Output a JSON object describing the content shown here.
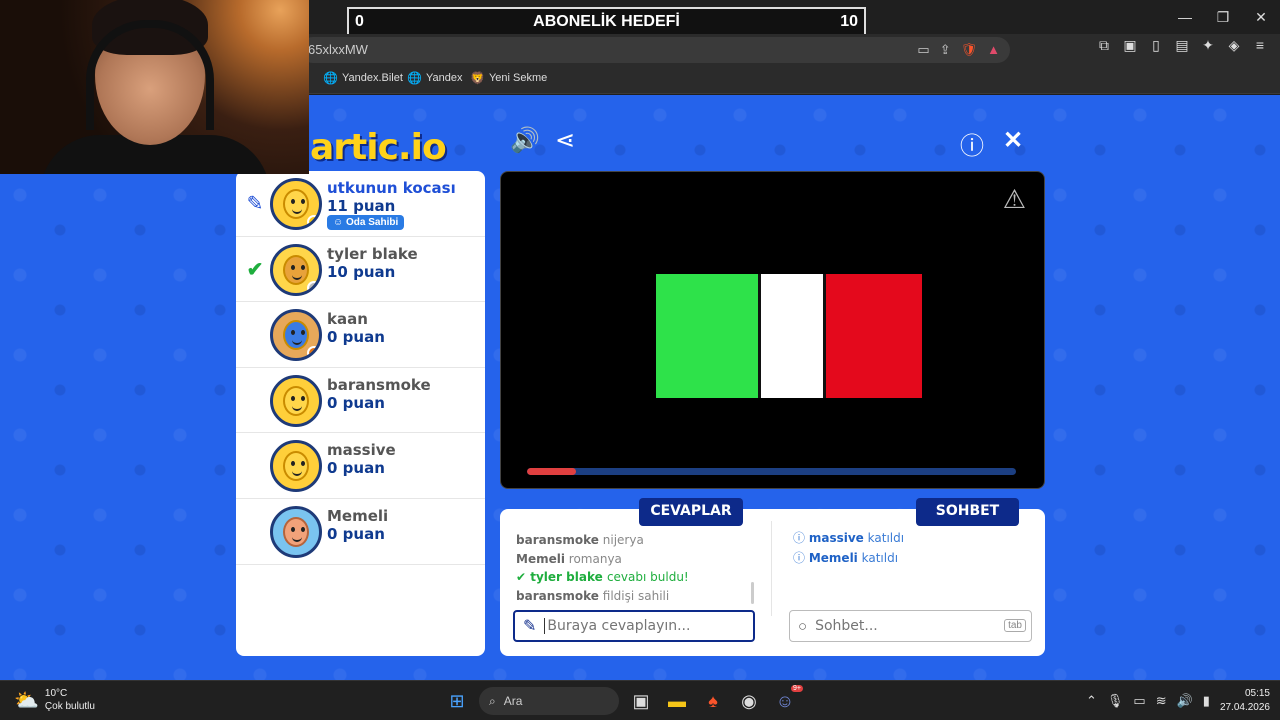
{
  "stream_overlay": {
    "goal_left": "0",
    "goal_title": "ABONELİK HEDEFİ",
    "goal_right": "10"
  },
  "window": {
    "minimize": "—",
    "maximize": "❐",
    "close": "✕"
  },
  "browser": {
    "url_fragment": "65xlxxMW",
    "bookmarks": [
      {
        "label": "Yandex.Bilet",
        "icon": "globe-icon"
      },
      {
        "label": "Yandex",
        "icon": "globe-icon"
      },
      {
        "label": "Yeni Sekme",
        "icon": "brave-icon"
      }
    ],
    "shield_count": "5"
  },
  "game": {
    "logo": "artic.io",
    "players": [
      {
        "name": "utkunun kocası",
        "score": "11 puan",
        "badge": "Oda Sahibi",
        "mark": "pencil-icon",
        "status_color": "#f5c518",
        "active": true
      },
      {
        "name": "tyler blake",
        "score": "10 puan",
        "mark": "check-icon",
        "status_color": "#bdbdbd",
        "active": false
      },
      {
        "name": "kaan",
        "score": "0 puan",
        "mark": "",
        "status_color": "#e07010",
        "active": false
      },
      {
        "name": "baransmoke",
        "score": "0 puan",
        "mark": "",
        "status_color": "",
        "active": false
      },
      {
        "name": "massive",
        "score": "0 puan",
        "mark": "",
        "status_color": "",
        "active": false
      },
      {
        "name": "Memeli",
        "score": "0 puan",
        "mark": "",
        "status_color": "",
        "active": false
      }
    ],
    "timer_progress": 0.1,
    "tabs": {
      "answers": "CEVAPLAR",
      "chat": "SOHBET"
    },
    "answers": [
      {
        "user": "baransmoke",
        "text": "nijerya"
      },
      {
        "user": "Memeli",
        "text": "romanya"
      },
      {
        "user": "tyler blake",
        "text": "cevabı buldu!",
        "correct": true
      },
      {
        "user": "baransmoke",
        "text": "fildişi sahili"
      }
    ],
    "chat": [
      {
        "user": "massive",
        "text": "katıldı"
      },
      {
        "user": "Memeli",
        "text": "katıldı"
      }
    ],
    "answer_placeholder": "Buraya cevaplayın...",
    "chat_placeholder": "Sohbet...",
    "tab_hint": "tab"
  },
  "taskbar": {
    "temperature": "10°C",
    "weather": "Çok bulutlu",
    "search": "Ara",
    "time": "05:15",
    "date": "27.04.2026",
    "discord_badge": "9+"
  }
}
